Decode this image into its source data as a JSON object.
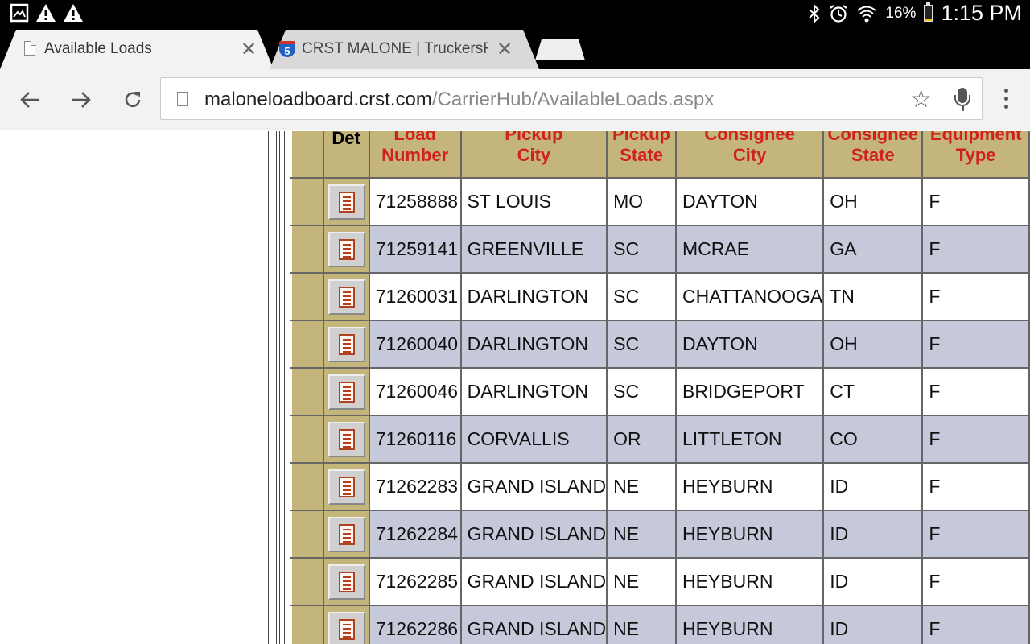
{
  "statusbar": {
    "battery_text": "16%",
    "battery_level": 0.16,
    "time": "1:15 PM",
    "left_icons": [
      "image-icon",
      "warning-icon",
      "warning-icon"
    ],
    "right_icons": [
      "bluetooth-icon",
      "alarm-icon",
      "wifi-icon",
      "battery-icon"
    ]
  },
  "tabs": [
    {
      "title": "Available Loads",
      "active": true,
      "icon": "document-icon"
    },
    {
      "title": "CRST MALONE | TruckersReport",
      "active": false,
      "icon": "interstate-shield-icon"
    }
  ],
  "toolbar": {
    "url_host": "maloneloadboard.crst.com",
    "url_path": "/CarrierHub/AvailableLoads.aspx"
  },
  "table": {
    "headers": {
      "det": "Det",
      "load_number_top": "Load",
      "load_number_bottom": "Number",
      "pickup_city_top": "Pickup",
      "pickup_city_bottom": "City",
      "pickup_state_top": "Pickup",
      "pickup_state_bottom": "State",
      "consignee_city_top": "Consignee",
      "consignee_city_bottom": "City",
      "consignee_state_top": "Consignee",
      "consignee_state_bottom": "State",
      "equipment_type_top": "Equipment",
      "equipment_type_bottom": "Type"
    },
    "rows": [
      {
        "load": "71258888",
        "pickup_city": "ST LOUIS",
        "pickup_state": "MO",
        "consignee_city": "DAYTON",
        "consignee_state": "OH",
        "equipment": "F"
      },
      {
        "load": "71259141",
        "pickup_city": "GREENVILLE",
        "pickup_state": "SC",
        "consignee_city": "MCRAE",
        "consignee_state": "GA",
        "equipment": "F"
      },
      {
        "load": "71260031",
        "pickup_city": "DARLINGTON",
        "pickup_state": "SC",
        "consignee_city": "CHATTANOOGA",
        "consignee_state": "TN",
        "equipment": "F"
      },
      {
        "load": "71260040",
        "pickup_city": "DARLINGTON",
        "pickup_state": "SC",
        "consignee_city": "DAYTON",
        "consignee_state": "OH",
        "equipment": "F"
      },
      {
        "load": "71260046",
        "pickup_city": "DARLINGTON",
        "pickup_state": "SC",
        "consignee_city": "BRIDGEPORT",
        "consignee_state": "CT",
        "equipment": "F"
      },
      {
        "load": "71260116",
        "pickup_city": "CORVALLIS",
        "pickup_state": "OR",
        "consignee_city": "LITTLETON",
        "consignee_state": "CO",
        "equipment": "F"
      },
      {
        "load": "71262283",
        "pickup_city": "GRAND ISLAND",
        "pickup_state": "NE",
        "consignee_city": "HEYBURN",
        "consignee_state": "ID",
        "equipment": "F"
      },
      {
        "load": "71262284",
        "pickup_city": "GRAND ISLAND",
        "pickup_state": "NE",
        "consignee_city": "HEYBURN",
        "consignee_state": "ID",
        "equipment": "F"
      },
      {
        "load": "71262285",
        "pickup_city": "GRAND ISLAND",
        "pickup_state": "NE",
        "consignee_city": "HEYBURN",
        "consignee_state": "ID",
        "equipment": "F"
      },
      {
        "load": "71262286",
        "pickup_city": "GRAND ISLAND",
        "pickup_state": "NE",
        "consignee_city": "HEYBURN",
        "consignee_state": "ID",
        "equipment": "F"
      }
    ]
  },
  "colors": {
    "header_bg": "#c4b57a",
    "header_text": "#d02020",
    "row_alt_bg": "#c5c9da",
    "battery_fill": "#f5c400"
  }
}
